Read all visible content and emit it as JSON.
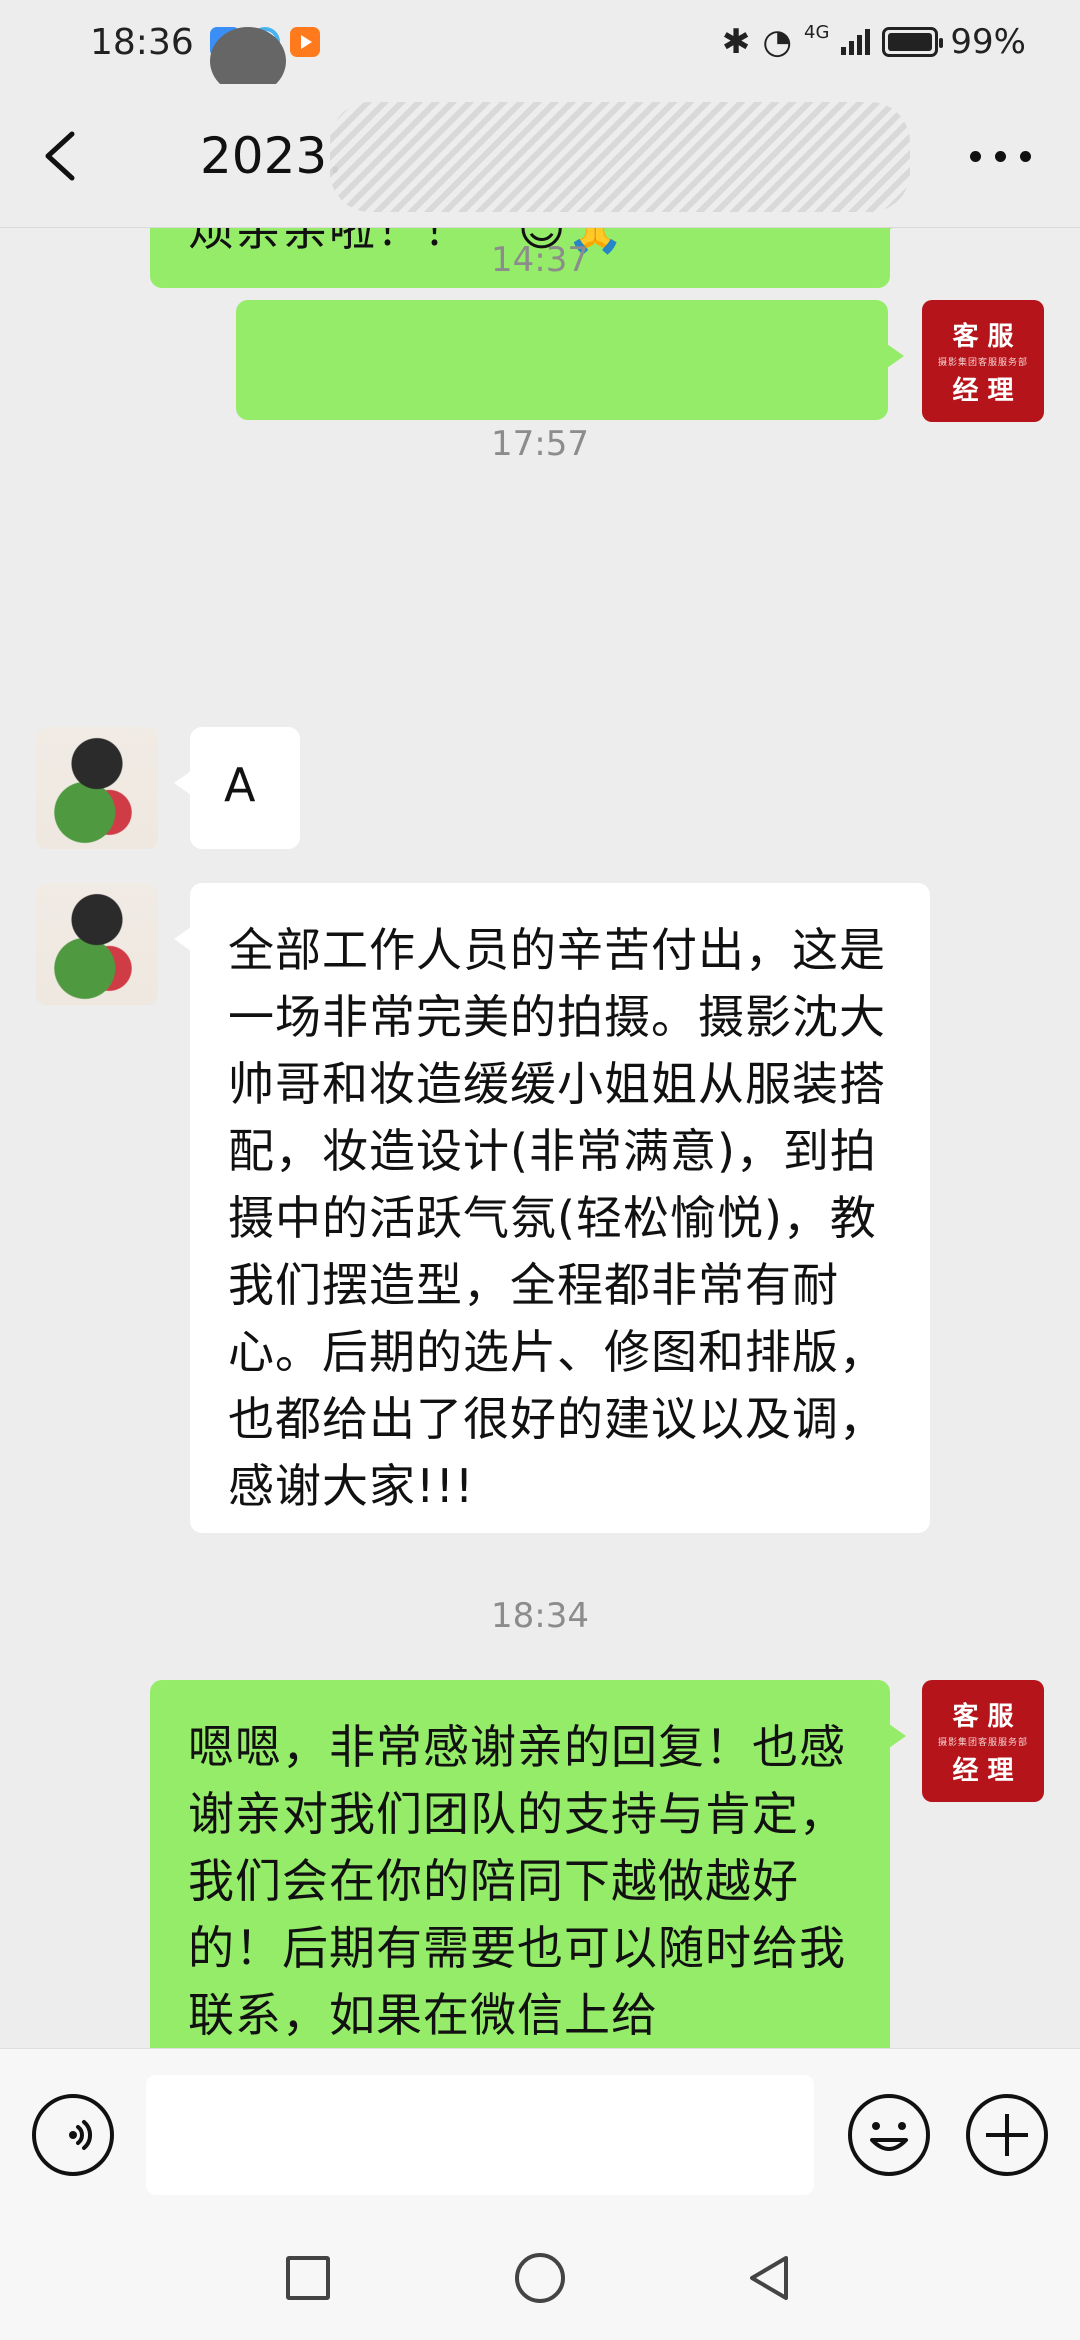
{
  "status": {
    "time": "18:36",
    "battery": "99%",
    "network": "4G"
  },
  "header": {
    "title": "2023."
  },
  "messages": {
    "time1": "14:37",
    "time2": "17:57",
    "time3": "18:34",
    "top_partial": "烦亲亲啦！！",
    "incoming_1": "A",
    "incoming_2": "全部工作人员的辛苦付出，这是一场非常完美的拍摄。摄影沈大帅哥和妆造缓缓小姐姐从服装搭配，妆造设计(非常满意)，到拍摄中的活跃气氛(轻松愉悦)，教我们摆造型，全程都非常有耐心。后期的选片、修图和排版，也都给出了很好的建议以及调，感谢大家!!!",
    "outgoing_2": "嗯嗯，非常感谢亲的回复！也感谢亲对我们团队的支持与肯定，我们会在你的陪同下越做越好的！后期有需要也可以随时给我联系，如果在微信上给"
  },
  "avatar": {
    "kefu_top": "客 服",
    "kefu_bottom": "经 理",
    "kefu_small": "摄影集团客服服务部"
  },
  "icons": [
    "back-icon",
    "more-icon",
    "voice-icon",
    "emoji-icon",
    "plus-icon",
    "home-square-icon",
    "home-circle-icon",
    "nav-back-icon"
  ]
}
